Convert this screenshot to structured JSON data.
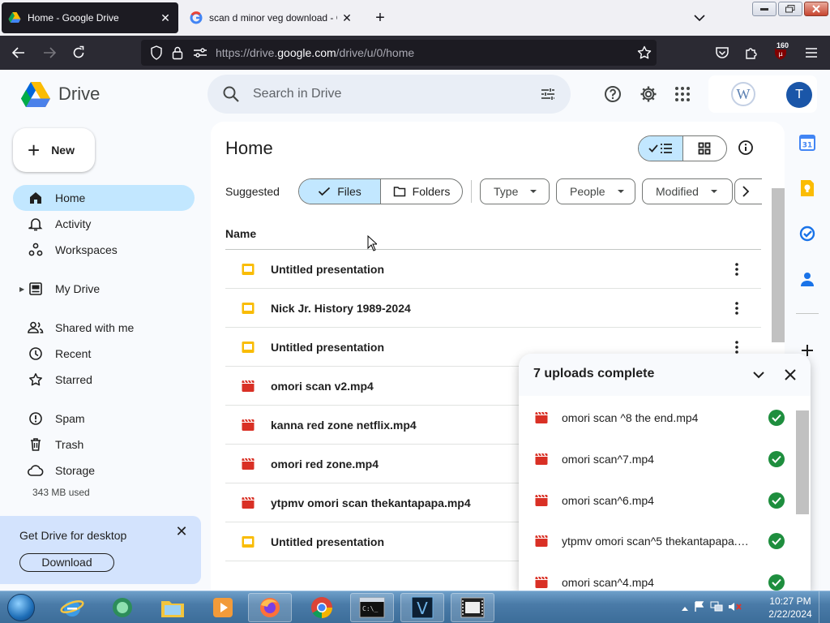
{
  "browser": {
    "tabs": [
      {
        "title": "Home - Google Drive",
        "active": true
      },
      {
        "title": "scan d minor veg download - G",
        "active": false
      }
    ],
    "url_prefix": "https://drive.",
    "url_domain": "google.com",
    "url_path": "/drive/u/0/home",
    "extension_badge": "160"
  },
  "drive": {
    "app_name": "Drive",
    "search_placeholder": "Search in Drive",
    "new_label": "New",
    "sidebar": [
      {
        "label": "Home",
        "icon": "home-icon",
        "active": true
      },
      {
        "label": "Activity",
        "icon": "bell-icon"
      },
      {
        "label": "Workspaces",
        "icon": "workspaces-icon"
      },
      {
        "label": "My Drive",
        "icon": "my-drive-icon"
      },
      {
        "label": "Shared with me",
        "icon": "people-icon"
      },
      {
        "label": "Recent",
        "icon": "clock-icon"
      },
      {
        "label": "Starred",
        "icon": "star-icon"
      },
      {
        "label": "Spam",
        "icon": "spam-icon"
      },
      {
        "label": "Trash",
        "icon": "trash-icon"
      },
      {
        "label": "Storage",
        "icon": "cloud-icon"
      }
    ],
    "storage_used": "343 MB used",
    "promo": {
      "title": "Get Drive for desktop",
      "button": "Download"
    },
    "main": {
      "title": "Home",
      "suggested_label": "Suggested",
      "files_label": "Files",
      "folders_label": "Folders",
      "filters": [
        "Type",
        "People",
        "Modified"
      ],
      "name_header": "Name",
      "files": [
        {
          "name": "Untitled presentation",
          "type": "slides"
        },
        {
          "name": "Nick Jr. History 1989-2024",
          "type": "slides"
        },
        {
          "name": "Untitled presentation",
          "type": "slides"
        },
        {
          "name": "omori scan v2.mp4",
          "type": "video"
        },
        {
          "name": "kanna red zone netflix.mp4",
          "type": "video"
        },
        {
          "name": "omori red zone.mp4",
          "type": "video"
        },
        {
          "name": "ytpmv omori scan thekantapapa.mp4",
          "type": "video"
        },
        {
          "name": "Untitled presentation",
          "type": "slides"
        }
      ]
    },
    "uploads": {
      "title": "7 uploads complete",
      "items": [
        "omori scan ^8 the end.mp4",
        "omori scan^7.mp4",
        "omori scan^6.mp4",
        "ytpmv omori scan^5 thekantapapa.mp4",
        "omori scan^4.mp4"
      ]
    },
    "account_initial": "T"
  },
  "colors": {
    "accent": "#c2e7ff",
    "slides": "#f9bc05",
    "video": "#d93025",
    "success": "#1e8e3e"
  },
  "taskbar": {
    "time": "10:27 PM",
    "date": "2/22/2024",
    "apps": [
      "start-orb",
      "internet-explorer",
      "media-center",
      "file-explorer",
      "media-player",
      "firefox",
      "chrome",
      "command-prompt",
      "vegas-pro",
      "video-editor"
    ]
  }
}
